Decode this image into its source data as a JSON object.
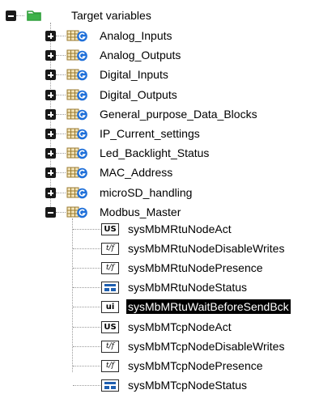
{
  "tree": {
    "root": {
      "label": "Target variables",
      "icon": "folder-icon"
    },
    "data_blocks": [
      {
        "label": "Analog_Inputs",
        "icon": "data-block-icon",
        "expanded": false
      },
      {
        "label": "Analog_Outputs",
        "icon": "data-block-icon",
        "expanded": false
      },
      {
        "label": "Digital_Inputs",
        "icon": "data-block-icon",
        "expanded": false
      },
      {
        "label": "Digital_Outputs",
        "icon": "data-block-icon",
        "expanded": false
      },
      {
        "label": "General_purpose_Data_Blocks",
        "icon": "data-block-icon",
        "expanded": false
      },
      {
        "label": "IP_Current_settings",
        "icon": "data-block-icon",
        "expanded": false
      },
      {
        "label": "Led_Backlight_Status",
        "icon": "data-block-icon",
        "expanded": false
      },
      {
        "label": "MAC_Address",
        "icon": "data-block-icon",
        "expanded": false
      },
      {
        "label": "microSD_handling",
        "icon": "data-block-icon",
        "expanded": false
      },
      {
        "label": "Modbus_Master",
        "icon": "data-block-icon",
        "expanded": true
      }
    ],
    "modbus_children": [
      {
        "label": "sysMbMRtuNodeAct",
        "type_badge": "US",
        "icon": "unsigned-short-icon",
        "selected": false
      },
      {
        "label": "sysMbMRtuNodeDisableWrites",
        "type_badge": "t/f",
        "icon": "boolean-icon",
        "selected": false
      },
      {
        "label": "sysMbMRtuNodePresence",
        "type_badge": "t/f",
        "icon": "boolean-icon",
        "selected": false
      },
      {
        "label": "sysMbMRtuNodeStatus",
        "type_badge": "",
        "icon": "struct-icon",
        "selected": false
      },
      {
        "label": "sysMbMRtuWaitBeforeSendBck",
        "type_badge": "ui",
        "icon": "unsigned-int-icon",
        "selected": true
      },
      {
        "label": "sysMbMTcpNodeAct",
        "type_badge": "US",
        "icon": "unsigned-short-icon",
        "selected": false
      },
      {
        "label": "sysMbMTcpNodeDisableWrites",
        "type_badge": "t/f",
        "icon": "boolean-icon",
        "selected": false
      },
      {
        "label": "sysMbMTcpNodePresence",
        "type_badge": "t/f",
        "icon": "boolean-icon",
        "selected": false
      },
      {
        "label": "sysMbMTcpNodeStatus",
        "type_badge": "",
        "icon": "struct-icon",
        "selected": false
      }
    ]
  },
  "colors": {
    "selection_bg": "#000000",
    "selection_fg": "#ffffff",
    "folder_green": "#2f9e3a",
    "db_grid": "#b98f3a",
    "db_badge_blue": "#1e6fd9",
    "struct_blue": "#1f5fb0"
  }
}
